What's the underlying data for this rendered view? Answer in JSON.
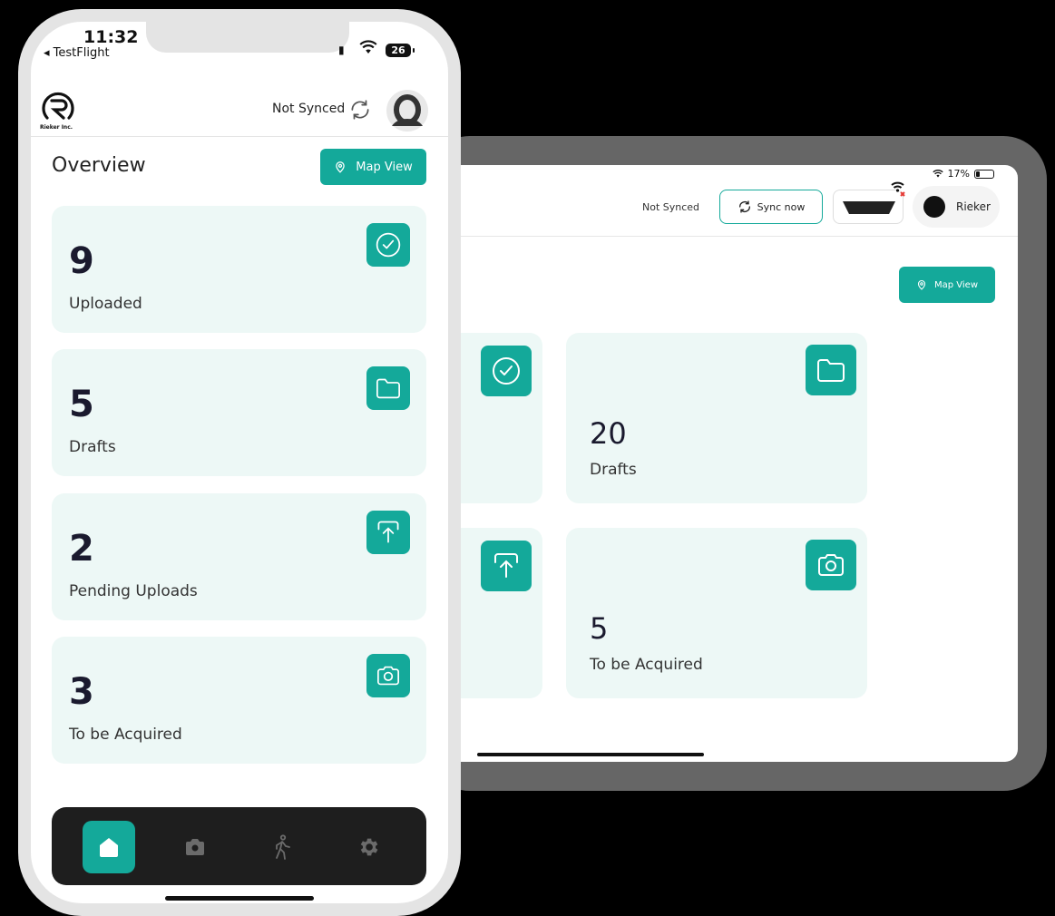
{
  "tablet": {
    "status": {
      "battery": "17%"
    },
    "header": {
      "sync_status": "Not Synced",
      "sync_button": "Sync now",
      "user_name": "Rieker"
    },
    "map_view_label": "Map View",
    "cards": [
      {
        "name": "drafts",
        "count": "20",
        "label": "Drafts"
      },
      {
        "name": "to-be-acquired",
        "count": "5",
        "label": "To be Acquired"
      }
    ]
  },
  "phone": {
    "status": {
      "time": "11:32",
      "back_app": "◂ TestFlight",
      "battery": "26"
    },
    "header": {
      "company": "Rieker Inc.",
      "sync_status": "Not Synced"
    },
    "title": "Overview",
    "map_view_label": "Map View",
    "cards": [
      {
        "name": "uploaded",
        "count": "9",
        "label": "Uploaded",
        "icon": "check-circle-icon"
      },
      {
        "name": "drafts",
        "count": "5",
        "label": "Drafts",
        "icon": "folder-icon"
      },
      {
        "name": "pending-uploads",
        "count": "2",
        "label": "Pending Uploads",
        "icon": "upload-icon"
      },
      {
        "name": "to-be-acquired",
        "count": "3",
        "label": "To be Acquired",
        "icon": "camera-icon"
      }
    ],
    "nav": [
      {
        "name": "home",
        "icon": "home-icon",
        "active": true
      },
      {
        "name": "camera",
        "icon": "camera-icon",
        "active": false
      },
      {
        "name": "activity",
        "icon": "walking-person-icon",
        "active": false
      },
      {
        "name": "settings",
        "icon": "gear-icon",
        "active": false
      }
    ]
  },
  "colors": {
    "accent": "#14a99a",
    "card_bg": "#edf8f6",
    "nav_bg": "#1e1e1e"
  }
}
